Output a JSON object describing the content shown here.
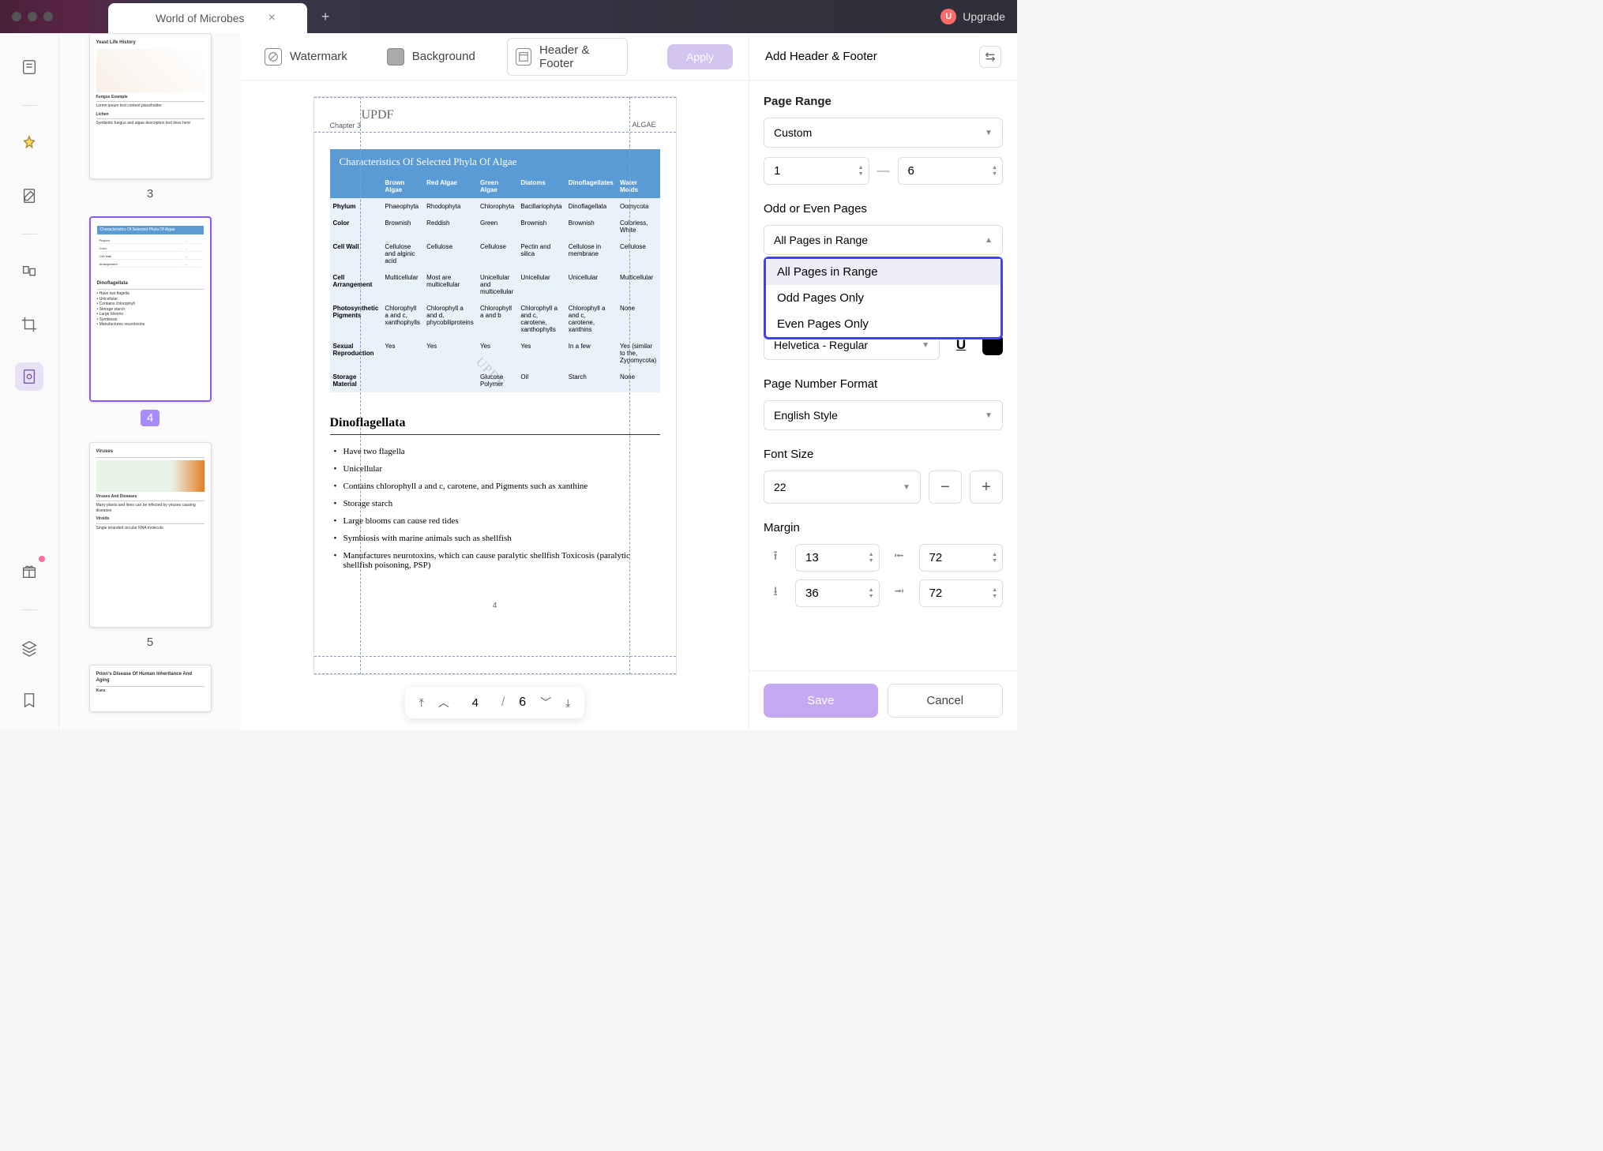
{
  "titlebar": {
    "tab_title": "World of Microbes",
    "upgrade_label": "Upgrade",
    "upgrade_badge": "U"
  },
  "top_tabs": {
    "watermark": "Watermark",
    "background": "Background",
    "header_footer": "Header & Footer",
    "apply": "Apply"
  },
  "thumbnails": {
    "page3_num": "3",
    "page4_num": "4",
    "page5_num": "5"
  },
  "page": {
    "watermark_text": "UPDF",
    "chapter": "Chapter 3",
    "corner_label": "ALGAE",
    "table_title": "Characteristics Of Selected Phyla Of Algae",
    "table_header": [
      "",
      "Brown Algae",
      "Red Algae",
      "Green Algae",
      "Diatoms",
      "Dinoflagellates",
      "Water Molds"
    ],
    "table_rows": [
      [
        "Phylum",
        "Phaeophyta",
        "Rhodophyta",
        "Chlorophyta",
        "Bacillariophyta",
        "Dinoflagellata",
        "Oomycota"
      ],
      [
        "Color",
        "Brownish",
        "Reddish",
        "Green",
        "Brownish",
        "Brownish",
        "Colorless, White"
      ],
      [
        "Cell Wall",
        "Cellulose and alginic acid",
        "Cellulose",
        "Cellulose",
        "Pectin and silica",
        "Cellulose in membrane",
        "Cellulose"
      ],
      [
        "Cell Arrangement",
        "Multicellular",
        "Most are multicellular",
        "Unicellular and multicellular",
        "Unicellular",
        "Unicellular",
        "Multicellular"
      ],
      [
        "Photosynthetic Pigments",
        "Chlorophyll a and c, xanthophylls",
        "Chlorophyll a and d, phycobiliproteins",
        "Chlorophyll a and b",
        "Chlorophyll a and c, carotene, xanthophylls",
        "Chlorophyll a and c, carotene, xanthins",
        "None"
      ],
      [
        "Sexual Reproduction",
        "Yes",
        "Yes",
        "Yes",
        "Yes",
        "In a few",
        "Yes (similar to the, Zygomycota)"
      ],
      [
        "Storage Material",
        "",
        "",
        "Glucose Polymer",
        "Oil",
        "Starch",
        "None"
      ]
    ],
    "dino_title": "Dinoflagellata",
    "dino_items": [
      "Have two flagella",
      "Unicellular",
      "Contains chlorophyll a and c, carotene, and Pigments such as xanthine",
      "Storage starch",
      "Large blooms can cause red tides",
      "Symbiosis with marine animals such as shellfish",
      "Manufactures neurotoxins, which can cause paralytic shellfish Toxicosis (paralytic shellfish poisoning, PSP)"
    ],
    "page_number": "4"
  },
  "pager": {
    "current": "4",
    "total": "6"
  },
  "rpanel": {
    "title": "Add Header & Footer",
    "page_range_label": "Page Range",
    "page_range_mode": "Custom",
    "range_from": "1",
    "range_to": "6",
    "odd_even_label": "Odd or Even Pages",
    "odd_even_selected": "All Pages in Range",
    "odd_even_options": [
      "All Pages in Range",
      "Odd Pages Only",
      "Even Pages Only"
    ],
    "font_name": "Helvetica - Regular",
    "pnf_label": "Page Number Format",
    "pnf_value": "English Style",
    "fs_label": "Font Size",
    "fs_value": "22",
    "margin_label": "Margin",
    "margin_top": "13",
    "margin_left": "72",
    "margin_bottom": "36",
    "margin_right": "72",
    "save": "Save",
    "cancel": "Cancel"
  }
}
